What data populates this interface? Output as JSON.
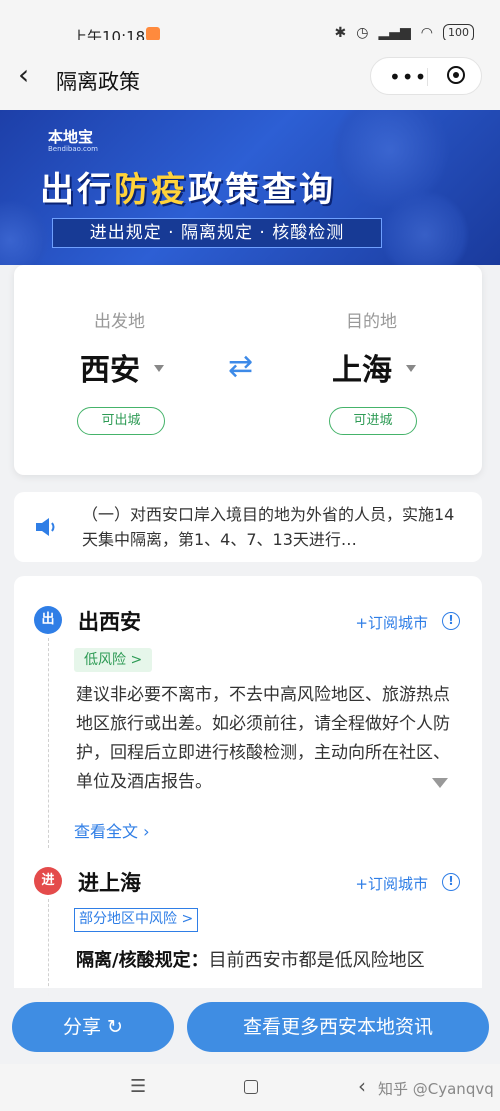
{
  "status": {
    "time": "上午10:18",
    "battery": "100"
  },
  "nav": {
    "back": "‹",
    "title": "隔离政策",
    "more": "•••"
  },
  "banner": {
    "logo": "本地宝",
    "logo_sub": "Bendibao.com",
    "title_a": "出行",
    "title_b": "防疫",
    "title_c": "政策查询",
    "strip": "进出规定 · 隔离规定 · 核酸检测"
  },
  "route": {
    "from_label": "出发地",
    "from_city": "西安",
    "from_status": "可出城",
    "to_label": "目的地",
    "to_city": "上海",
    "to_status": "可进城",
    "swap": "⇄"
  },
  "notice": {
    "text": "（一）对西安口岸入境目的地为外省的人员，实施14天集中隔离，第1、4、7、13天进行…"
  },
  "out_section": {
    "icon": "出",
    "title": "出西安",
    "subscribe": "+订阅城市",
    "info": "!",
    "risk": "低风险 >",
    "body": "建议非必要不离市，不去中高风险地区、旅游热点地区旅行或出差。如必须前往，请全程做好个人防护，回程后立即进行核酸检测，主动向所在社区、单位及酒店报告。",
    "view_all": "查看全文 ›"
  },
  "in_section": {
    "icon": "进",
    "title": "进上海",
    "subscribe": "+订阅城市",
    "info": "!",
    "risk": "部分地区中风险 >",
    "rule_label": "隔离/核酸规定：",
    "rule_text": "目前西安市都是低风险地区"
  },
  "buttons": {
    "share": "分享 ↻",
    "more": "查看更多西安本地资讯"
  },
  "sysnav": {
    "menu": "☰",
    "back": "‹",
    "watermark": "知乎 @Cyanqvq"
  }
}
